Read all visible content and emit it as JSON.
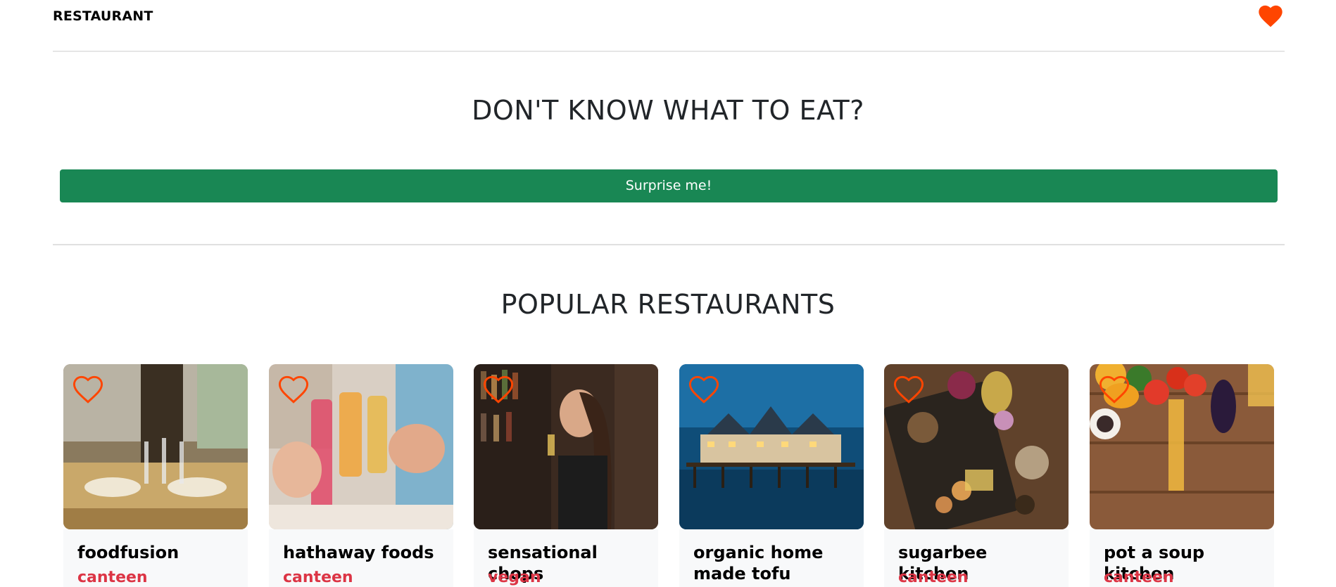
{
  "navbar": {
    "brand": "RESTAURANT",
    "favorites_icon": "heart-filled-icon",
    "favorites_color": "#ff4500"
  },
  "hero": {
    "title": "DON'T KNOW WHAT TO EAT?",
    "button_label": "Surprise me!",
    "button_color": "#198754"
  },
  "popular": {
    "title": "POPULAR RESTAURANTS",
    "heart_icon": "heart-outline-icon",
    "tag_color": "#dc3545",
    "cards": [
      {
        "name": "foodfusion",
        "tag": "canteen"
      },
      {
        "name": "hathaway foods",
        "tag": "canteen"
      },
      {
        "name": "sensational chops",
        "tag": "vegan"
      },
      {
        "name": "organic home made tofu",
        "tag": ""
      },
      {
        "name": "sugarbee kitchen",
        "tag": "canteen"
      },
      {
        "name": "pot a soup kitchen",
        "tag": "canteen"
      }
    ]
  }
}
